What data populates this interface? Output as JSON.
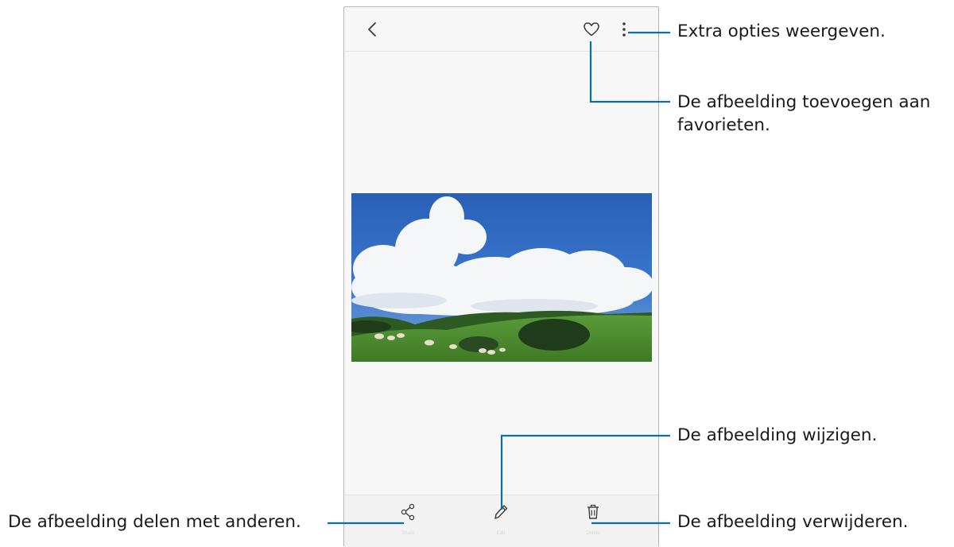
{
  "viewer": {
    "top_actions": {
      "back_icon": "chevron-left-icon",
      "favorite_icon": "heart-outline-icon",
      "more_icon": "more-vertical-icon"
    },
    "photo": {
      "subject": "landscape-with-sheep",
      "sky_color": "#2f68c0",
      "grass_color": "#4b8a30"
    },
    "bottom_actions": [
      {
        "icon": "share-icon",
        "label": "Share"
      },
      {
        "icon": "edit-pencil-icon",
        "label": "Edit"
      },
      {
        "icon": "trash-icon",
        "label": "Delete"
      }
    ]
  },
  "callouts": {
    "more_options": "Extra opties weergeven.",
    "favorite_line1": "De afbeelding toevoegen aan",
    "favorite_line2": "favorieten.",
    "edit": "De afbeelding wijzigen.",
    "share": "De afbeelding delen met anderen.",
    "delete": "De afbeelding verwijderen."
  },
  "colors": {
    "accent_line": "#0a6fa3",
    "text": "#1a1a1a",
    "frame_border": "#b5b5b5"
  }
}
